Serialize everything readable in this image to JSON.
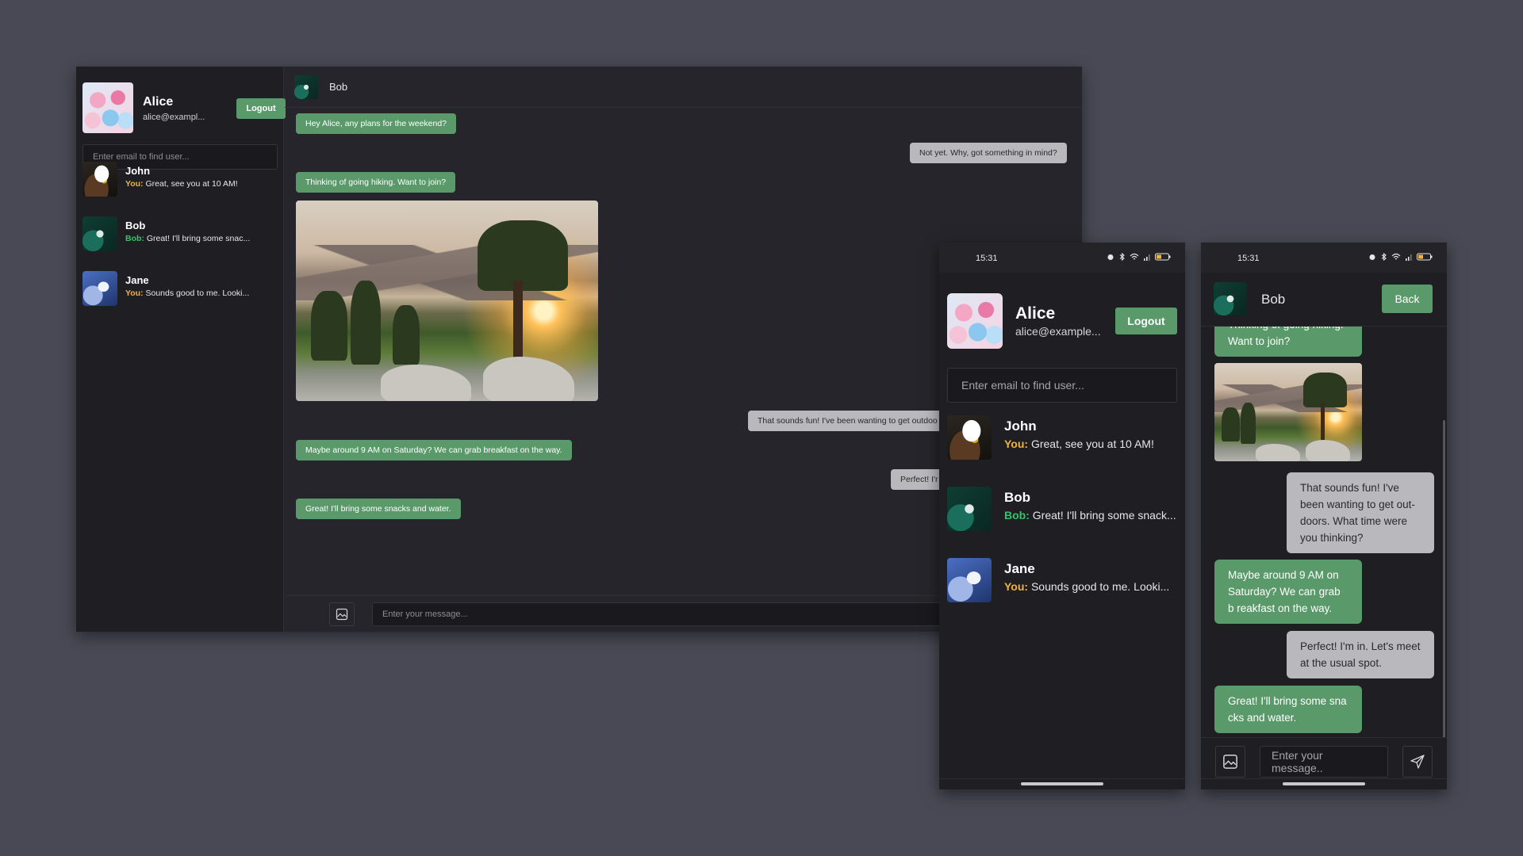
{
  "colors": {
    "background": "#484954",
    "accent": "#5a9a6a",
    "incoming_bubble": "#5a9a6a",
    "outgoing_bubble": "#b9b9bd",
    "you_label": "#f2b33d",
    "bob_label": "#35c46a"
  },
  "desktop": {
    "profile": {
      "name": "Alice",
      "email": "alice@exampl...",
      "logout_label": "Logout"
    },
    "search_placeholder": "Enter email to find user...",
    "conversations": [
      {
        "name": "John",
        "sender": "You:",
        "preview": "Great, see you at 10 AM!",
        "avatar": "eagle-avatar"
      },
      {
        "name": "Bob",
        "sender": "Bob:",
        "preview": "Great! I'll bring some snac...",
        "avatar": "bird-avatar"
      },
      {
        "name": "Jane",
        "sender": "You:",
        "preview": "Sounds good to me. Looki...",
        "avatar": "ice-avatar"
      }
    ],
    "chat": {
      "contact": "Bob",
      "messages": [
        {
          "direction": "in",
          "text": "Hey Alice, any plans for the weekend?"
        },
        {
          "direction": "out",
          "text": "Not yet. Why, got something in mind?"
        },
        {
          "direction": "in",
          "text": "Thinking of going hiking. Want to join?"
        },
        {
          "direction": "in",
          "type": "image",
          "alt": "mountain-landscape-photo"
        },
        {
          "direction": "out",
          "text": "That sounds fun! I've been wanting to get outdoo"
        },
        {
          "direction": "in",
          "text": "Maybe around 9 AM on Saturday? We can grab breakfast on the way."
        },
        {
          "direction": "out",
          "text": "Perfect! I'r"
        },
        {
          "direction": "in",
          "text": "Great! I'll bring some snacks and water."
        }
      ],
      "input_placeholder": "Enter your message..."
    }
  },
  "phone1": {
    "status_time": "15:31",
    "profile": {
      "name": "Alice",
      "email": "alice@example...",
      "logout_label": "Logout"
    },
    "search_placeholder": "Enter email to find user...",
    "conversations": [
      {
        "name": "John",
        "sender": "You:",
        "preview": "Great, see you at 10 AM!"
      },
      {
        "name": "Bob",
        "sender": "Bob:",
        "preview": "Great! I'll bring some snack..."
      },
      {
        "name": "Jane",
        "sender": "You:",
        "preview": "Sounds good to me. Looki..."
      }
    ]
  },
  "phone2": {
    "status_time": "15:31",
    "contact": "Bob",
    "back_label": "Back",
    "messages": [
      {
        "direction": "in",
        "text": "Thinking of going hiking. Want to join?"
      },
      {
        "direction": "in",
        "type": "image",
        "alt": "mountain-landscape-photo"
      },
      {
        "direction": "out",
        "text": "That sounds fun! I've been wanting to get out-doors. What time were you thinking?"
      },
      {
        "direction": "in",
        "text": "Maybe around 9 AM on Saturday? We can grab b reakfast on the way."
      },
      {
        "direction": "out",
        "text": "Perfect! I'm in. Let's meet at the usual spot."
      },
      {
        "direction": "in",
        "text": "Great! I'll bring some sna cks and water."
      }
    ],
    "input_placeholder": "Enter your message.."
  }
}
